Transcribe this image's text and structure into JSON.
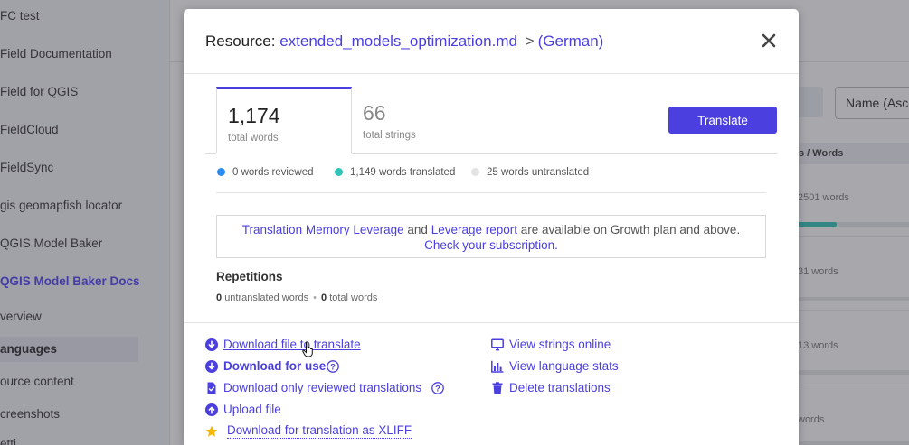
{
  "sidebar": {
    "items": [
      {
        "label": "FC test"
      },
      {
        "label": "Field Documentation"
      },
      {
        "label": "Field for QGIS"
      },
      {
        "label": "FieldCloud"
      },
      {
        "label": "FieldSync"
      },
      {
        "label": "gis geomapfish locator"
      },
      {
        "label": "QGIS Model Baker"
      },
      {
        "label": "QGIS Model Baker Docs"
      },
      {
        "label": "verview"
      },
      {
        "label": "anguages"
      },
      {
        "label": "ource content"
      },
      {
        "label": "creenshots"
      },
      {
        "label": "etti"
      }
    ]
  },
  "background": {
    "sort_select": "Name (Asce",
    "table_header": "s / Words",
    "rows": [
      {
        "words": "2501 words",
        "progress_fraction": 0.39
      },
      {
        "words": "31 words",
        "progress_fraction": 0
      },
      {
        "words": "13 words",
        "progress_fraction": 0
      },
      {
        "words": "words",
        "progress_fraction": 0
      }
    ]
  },
  "modal": {
    "title_prefix": "Resource:",
    "resource_name": "extended_models_optimization.md",
    "separator": ">",
    "language": "(German)",
    "close_icon": "close-x-icon",
    "stats": {
      "total_words": "1,174",
      "total_words_label": "total words",
      "total_strings": "66",
      "total_strings_label": "total strings"
    },
    "translate_button": "Translate",
    "legend": {
      "reviewed": "0 words reviewed",
      "translated": "1,149 words translated",
      "untranslated": "25 words untranslated",
      "colors": {
        "reviewed": "#2d8cf0",
        "translated": "#2ec4b6",
        "untranslated": "#e3e3e3"
      }
    },
    "notice": {
      "link1": "Translation Memory Leverage",
      "and": "and",
      "link2": "Leverage report",
      "rest": "are available on Growth plan and above.",
      "link3": "Check your subscription",
      "period": "."
    },
    "repetitions": {
      "title": "Repetitions",
      "untranslated_count": "0",
      "untranslated_label": "untranslated words",
      "bullet": "•",
      "total_count": "0",
      "total_label": "total words"
    },
    "actions_left": [
      {
        "label": "Download file to translate",
        "icon": "download-circle-icon"
      },
      {
        "label": "Download for use",
        "icon": "download-circle-icon"
      },
      {
        "label": "Download only reviewed translations",
        "icon": "file-check-icon"
      },
      {
        "label": "Upload file",
        "icon": "upload-circle-icon"
      },
      {
        "label": "Download for translation as XLIFF",
        "icon": "star-icon"
      }
    ],
    "actions_right": [
      {
        "label": "View strings online",
        "icon": "monitor-icon"
      },
      {
        "label": "View language stats",
        "icon": "bar-chart-icon"
      },
      {
        "label": "Delete translations",
        "icon": "trash-icon"
      }
    ]
  },
  "colors": {
    "accent": "#4b3fe0",
    "star": "#f5b800"
  }
}
